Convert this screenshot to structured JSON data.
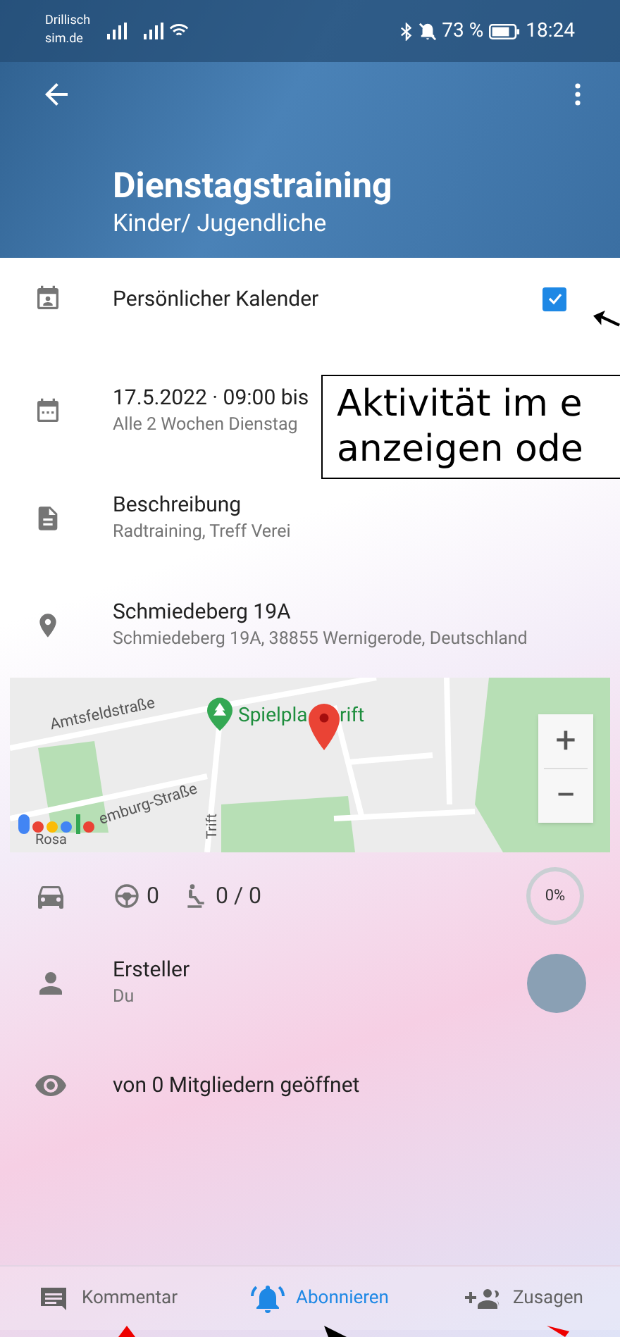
{
  "status_bar": {
    "carrier_line1": "Drillisch",
    "carrier_line2": "sim.de",
    "battery": "73 %",
    "time": "18:24"
  },
  "header": {
    "title": "Dienstagstraining",
    "subtitle": "Kinder/ Jugendliche"
  },
  "calendar_row": {
    "label": "Persönlicher Kalender",
    "checked": true
  },
  "date_row": {
    "title": "17.5.2022 · 09:00 bis",
    "subtitle": "Alle 2 Wochen Dienstag"
  },
  "description_row": {
    "title": "Beschreibung",
    "subtitle": "Radtraining, Treff Verei"
  },
  "location_row": {
    "title": "Schmiedeberg 19A",
    "subtitle": "Schmiedeberg 19A, 38855 Wernigerode, Deutschland"
  },
  "map": {
    "labels": [
      "Amtsfeldstraße",
      "Spielpla",
      "rift",
      "emburg-Straße",
      "Trift",
      "Rosa"
    ],
    "zoom_in": "+",
    "zoom_out": "−"
  },
  "carpool_row": {
    "drivers": "0",
    "seats": "0 / 0",
    "percent": "0%",
    "level": 0
  },
  "creator_row": {
    "title": "Ersteller",
    "subtitle": "Du"
  },
  "views_row": {
    "label": "von 0 Mitgliedern geöffnet"
  },
  "callout": {
    "lines": [
      "Aktivität im e",
      "anzeigen ode"
    ]
  },
  "bottom_nav": [
    {
      "kind": "comment",
      "label": "Kommentar",
      "selected": false
    },
    {
      "kind": "subscribe",
      "label": "Abonnieren",
      "selected": true
    },
    {
      "kind": "accept",
      "label": "Zusagen",
      "selected": false
    }
  ]
}
